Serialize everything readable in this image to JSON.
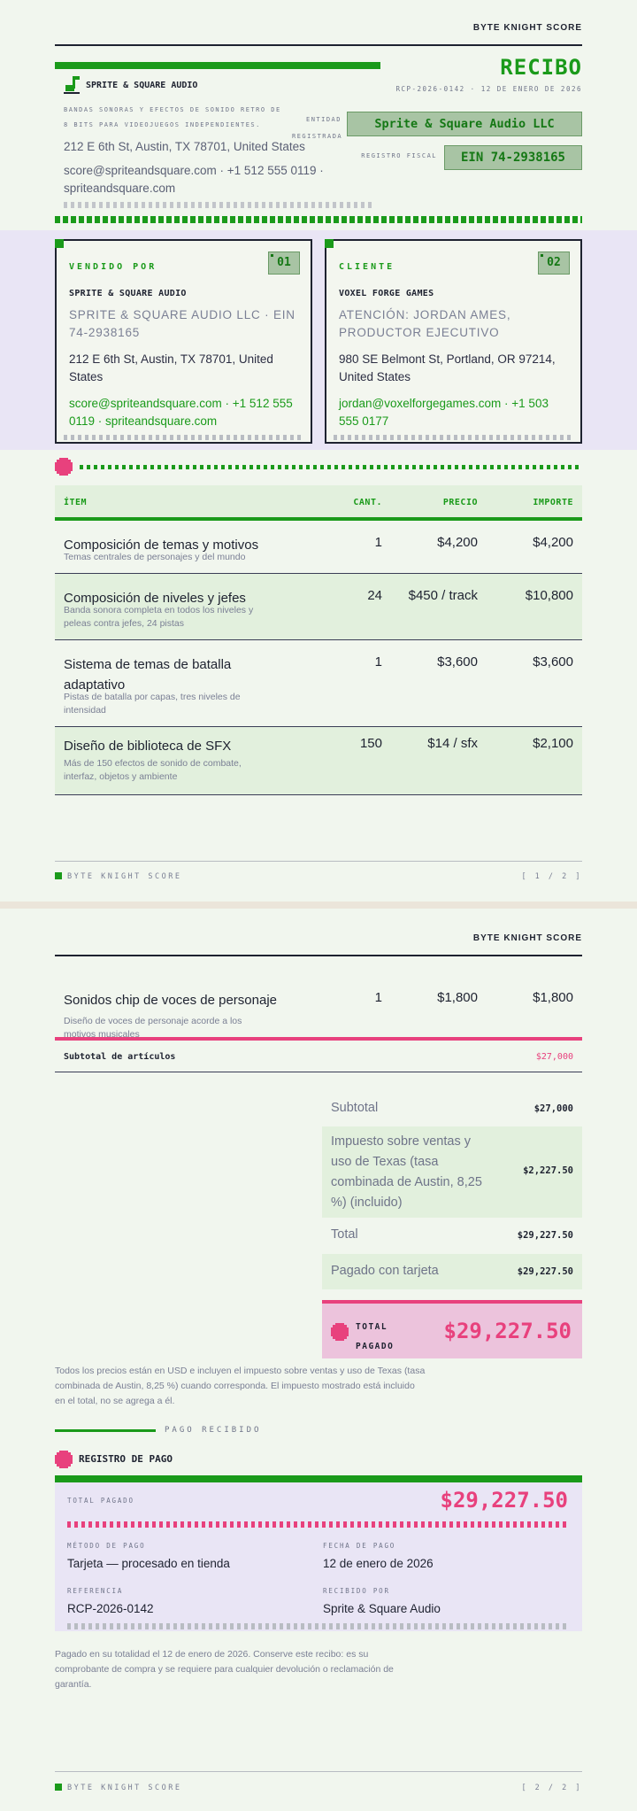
{
  "brand": "BYTE KNIGHT SCORE",
  "receipt": {
    "title": "RECIBO",
    "meta": "RCP-2026-0142 · 12 DE ENERO DE 2026"
  },
  "seller": {
    "logo_name": "SPRITE & SQUARE AUDIO",
    "tagline": "BANDAS SONORAS Y EFECTOS DE SONIDO RETRO DE 8 BITS PARA VIDEOJUEGOS INDEPENDIENTES.",
    "address": "212 E 6th St, Austin, TX 78701, United States",
    "contact": "score@spriteandsquare.com · +1 512 555 0119 · spriteandsquare.com",
    "entity_label": "ENTIDAD REGISTRADA",
    "entity_value": "Sprite & Square Audio LLC",
    "tax_label": "REGISTRO FISCAL",
    "tax_value": "EIN 74-2938165"
  },
  "cards": [
    {
      "number": "01",
      "caption": "VENDIDO POR",
      "name": "SPRITE & SQUARE AUDIO",
      "sub": "SPRITE & SQUARE AUDIO LLC · EIN 74-2938165",
      "address": "212 E 6th St, Austin, TX 78701, United States",
      "contact": "score@spriteandsquare.com · +1 512 555 0119 · spriteandsquare.com"
    },
    {
      "number": "02",
      "caption": "CLIENTE",
      "name": "VOXEL FORGE GAMES",
      "sub": "ATENCIÓN: JORDAN AMES, PRODUCTOR EJECUTIVO",
      "address": "980 SE Belmont St, Portland, OR 97214, United States",
      "contact": "jordan@voxelforgegames.com · +1 503 555 0177"
    }
  ],
  "table": {
    "headers": {
      "item": "ÍTEM",
      "qty": "CANT.",
      "price": "PRECIO",
      "amount": "IMPORTE"
    },
    "rows": [
      {
        "desc": "Composición de temas y motivos",
        "note": "Temas centrales de personajes y del mundo",
        "qty": "1",
        "price": "$4,200",
        "amount": "$4,200"
      },
      {
        "desc": "Composición de niveles y jefes",
        "note": "Banda sonora completa en todos los niveles y peleas contra jefes, 24 pistas",
        "qty": "24",
        "price": "$450 / track",
        "amount": "$10,800"
      },
      {
        "desc": "Sistema de temas de batalla adaptativo",
        "note": "Pistas de batalla por capas, tres niveles de intensidad",
        "qty": "1",
        "price": "$3,600",
        "amount": "$3,600"
      },
      {
        "desc": "Diseño de biblioteca de SFX",
        "note": "Más de 150 efectos de sonido de combate, interfaz, objetos y ambiente",
        "qty": "150",
        "price": "$14 / sfx",
        "amount": "$2,100"
      },
      {
        "desc": "Sonidos chip de voces de personaje",
        "note": "Diseño de voces de personaje acorde a los motivos musicales",
        "qty": "1",
        "price": "$1,800",
        "amount": "$1,800"
      }
    ]
  },
  "footer": {
    "brand": "BYTE KNIGHT SCORE",
    "page1": "[ 1 / 2 ]",
    "page2": "[ 2 / 2 ]"
  },
  "subtotal_items": {
    "label": "Subtotal de artículos",
    "value": "$27,000"
  },
  "totals": {
    "subtotal_label": "Subtotal",
    "subtotal_value": "$27,000",
    "tax_label": "Impuesto sobre ventas y uso de Texas (tasa combinada de Austin, 8,25 %) (incluido)",
    "tax_value": "$2,227.50",
    "total_label": "Total",
    "total_value": "$29,227.50",
    "paid_label": "Pagado con tarjeta",
    "paid_value": "$29,227.50",
    "grand_label": "TOTAL PAGADO",
    "grand_value": "$29,227.50"
  },
  "tax_note": "Todos los precios están en USD e incluyen el impuesto sobre ventas y uso de Texas (tasa combinada de Austin, 8,25 %) cuando corresponda. El impuesto mostrado está incluido en el total, no se agrega a él.",
  "payment": {
    "section_label": "PAGO RECIBIDO",
    "heading": "REGISTRO DE PAGO",
    "total_label": "TOTAL PAGADO",
    "total_value": "$29,227.50",
    "method_label": "MÉTODO DE PAGO",
    "method_value": "Tarjeta — procesado en tienda",
    "date_label": "FECHA DE PAGO",
    "date_value": "12 de enero de 2026",
    "ref_label": "REFERENCIA",
    "ref_value": "RCP-2026-0142",
    "received_label": "RECIBIDO POR",
    "received_value": "Sprite & Square Audio"
  },
  "closing_note": "Pagado en su totalidad el 12 de enero de 2026. Conserve este recibo: es su comprobante de compra y se requiere para cualquier devolución o reclamación de garantía.",
  "colors": {
    "green": "#1a9a1a",
    "pink": "#e8417d",
    "navy": "#1e2230",
    "lavender": "#e9e5f5",
    "pale_green": "#e2f0dd"
  }
}
